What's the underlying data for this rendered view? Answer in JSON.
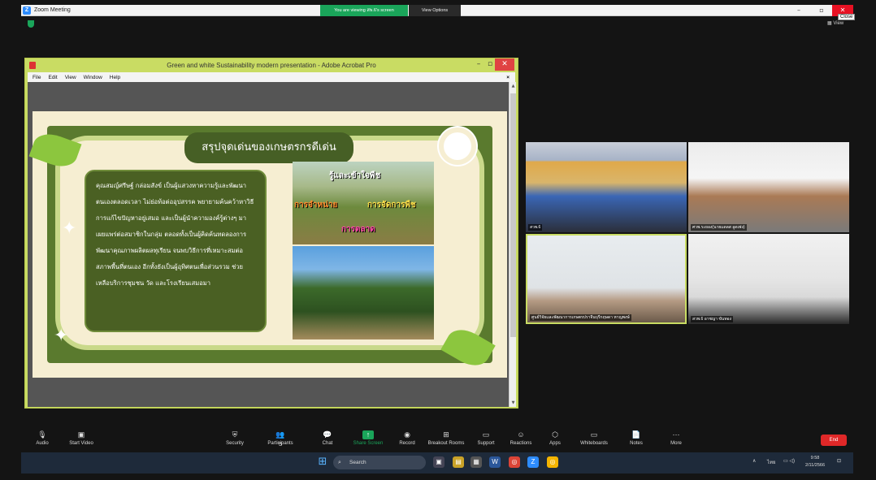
{
  "zoom": {
    "title": "Zoom Meeting",
    "logo": "Z",
    "sharing_banner": "You are viewing สพ.6's screen",
    "view_options": "View Options",
    "close_tooltip": "Close",
    "view_label": "View"
  },
  "acrobat": {
    "title": "Green and white Sustainability modern presentation - Adobe Acrobat Pro",
    "menu": [
      "File",
      "Edit",
      "View",
      "Window",
      "Help"
    ]
  },
  "slide": {
    "heading": "สรุปจุดเด่นของเกษตรกรดีเด่น",
    "body": "คุณสมญ์ศรีษฐ์ กล่อมสังข์ เป็นผู้แสวงหาความรู้และพัฒนาตนเองตลอดเวลา ไม่ย่อท้อต่ออุปสรรค พยายามค้นคว้าหาวิธีการแก้ไขปัญหาอยู่เสมอ และเป็นผู้นำความองค์รู้ต่างๆ มาเผยแพร่ต่อสมาชิกในกลุ่ม ตลอดทั้งเป็นผู้คิดค้นทดลองการพัฒนาคุณภาพผลิตผลทุเรียน จนพบวิธีการที่เหมาะสมต่อสภาพพื้นที่ตนเอง อีกทั้งยังเป็นผู้อุทิศตนเพื่อส่วนรวม ช่วยเหลือบริการชุมชน วัด และโรงเรียนเสมอมา",
    "photo_labels": {
      "understand": "รู้และเข้าใจพืช",
      "manage": "การจัดการพืช",
      "sell": "การจำหน่าย",
      "market": "การตลาด"
    }
  },
  "gallery": [
    {
      "name": "สวพ.6"
    },
    {
      "name": "ศวพ.ระยอง(นายแดลส อูดเพ่ง)"
    },
    {
      "name": "ศูนย์วิจัยและพัฒนาการเกษตรปราจีนบุรีกฤษดา หาญพงษ์"
    },
    {
      "name": "สวพ.6 อาชญา ขันทอง"
    }
  ],
  "toolbar": {
    "audio": "Audio",
    "video": "Start Video",
    "security": "Security",
    "participants": "Participants",
    "participants_count": "5",
    "chat": "Chat",
    "share": "Share Screen",
    "record": "Record",
    "breakout": "Breakout Rooms",
    "support": "Support",
    "reactions": "Reactions",
    "apps": "Apps",
    "whiteboards": "Whiteboards",
    "notes": "Notes",
    "more": "More",
    "end": "End"
  },
  "taskbar": {
    "search": "Search",
    "lang": "ไทย",
    "time": "9:58",
    "date": "2/11/2566"
  },
  "colors": {
    "zoom_blue": "#2d8cff",
    "share_green": "#1aa55a",
    "acrobat_frame": "#c9dc63",
    "slide_green": "#4a6023",
    "end_red": "#e02828"
  }
}
